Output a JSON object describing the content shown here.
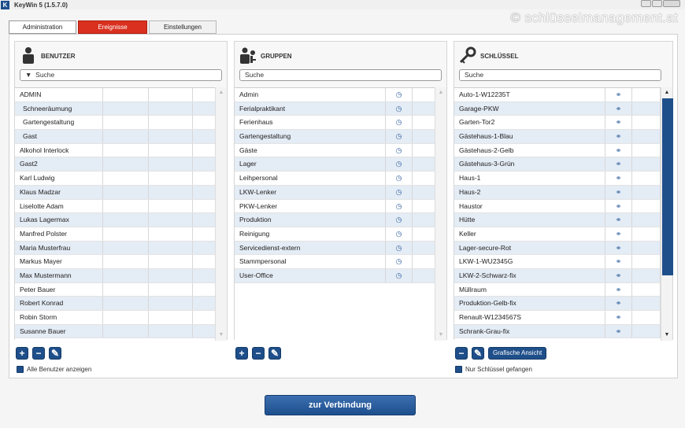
{
  "app": {
    "icon_letter": "K",
    "title": "KeyWin 5 (1.5.7.0)"
  },
  "watermark": "© schlüsselmanagement.at",
  "tabs": [
    "Administration",
    "Ereignisse",
    "Einstellungen"
  ],
  "benutzer": {
    "title": "BENUTZER",
    "search_prefix": "▼",
    "search": "Suche",
    "rows": [
      "ADMIN",
      "Schneeräumung",
      "Gartengestaltung",
      "Gast",
      "Alkohol Interlock",
      "Gast2",
      "Karl Ludwig",
      "Klaus Madzar",
      "Liselotte Adam",
      "Lukas Lagermax",
      "Manfred Polster",
      "Maria Musterfrau",
      "Markus Mayer",
      "Max Mustermann",
      "Peter Bauer",
      "Robert Konrad",
      "Robin Storm",
      "Susanne Bauer"
    ],
    "checkbox": "Alle Benutzer anzeigen"
  },
  "gruppen": {
    "title": "GRUPPEN",
    "search": "Suche",
    "rows": [
      "Admin",
      "Ferialpraktikant",
      "Ferienhaus",
      "Gartengestaltung",
      "Gäste",
      "Lager",
      "Leihpersonal",
      "LKW-Lenker",
      "PKW-Lenker",
      "Produktion",
      "Reinigung",
      "Servicedienst-extern",
      "Stammpersonal",
      "User-Office"
    ]
  },
  "schluessel": {
    "title": "SCHLÜSSEL",
    "search": "Suche",
    "rows": [
      "Auto-1-W12235T",
      "Garage-PKW",
      "Garten-Tor2",
      "Gästehaus-1-Blau",
      "Gästehaus-2-Gelb",
      "Gästehaus-3-Grün",
      "Haus-1",
      "Haus-2",
      "Haustor",
      "Hütte",
      "Keller",
      "Lager-secure-Rot",
      "LKW-1-WU2345G",
      "LKW-2-Schwarz-fix",
      "Müllraum",
      "Produktion-Gelb-fix",
      "Renault-W1234567S",
      "Schrank-Grau-fix"
    ],
    "grafik_button": "Grafische Ansicht",
    "checkbox": "Nur Schlüssel gefangen"
  },
  "buttons": {
    "add": "+",
    "remove": "−",
    "edit": "✎"
  },
  "connect_button": "zur Verbindung",
  "icons": {
    "group_row": "clock-icon",
    "key_row": "key-icon"
  },
  "colors": {
    "accent": "#1f4f8a",
    "tab_active": "#d9301f"
  }
}
